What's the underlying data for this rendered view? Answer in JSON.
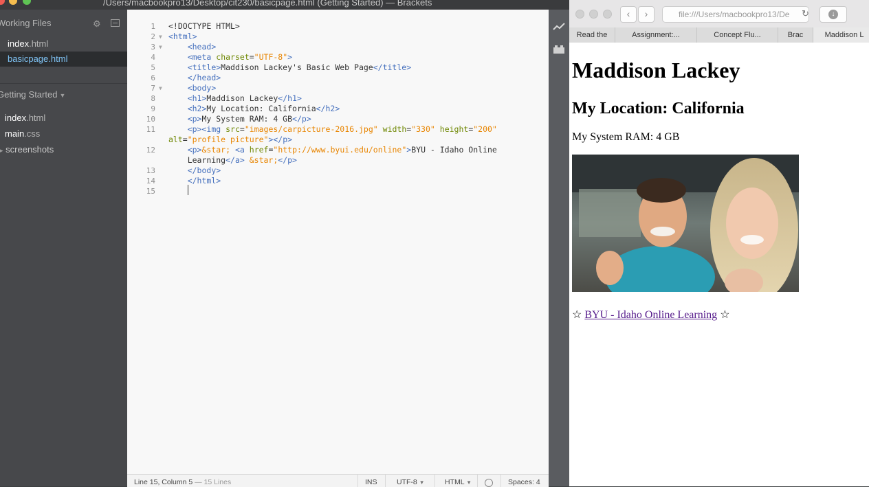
{
  "window": {
    "title": "/Users/macbookpro13/Desktop/cit230/basicpage.html (Getting Started) — Brackets"
  },
  "sidebar": {
    "working_files_title": "Working Files",
    "working_files": [
      {
        "name": "index",
        "ext": ".html",
        "selected": false
      },
      {
        "name": "basicpage",
        "ext": ".html",
        "selected": true
      }
    ],
    "project_title": "Getting Started",
    "project_items": [
      {
        "name": "index",
        "ext": ".html"
      },
      {
        "name": "main",
        "ext": ".css"
      },
      {
        "name": "screenshots",
        "ext": ""
      }
    ]
  },
  "editor": {
    "lines": [
      {
        "num": "1",
        "fold": "",
        "html": "&lt;!DOCTYPE HTML&gt;"
      },
      {
        "num": "2",
        "fold": "▼",
        "html": "<span class='tag'>&lt;html&gt;</span>"
      },
      {
        "num": "3",
        "fold": "▼",
        "html": "    <span class='tag'>&lt;head&gt;</span>"
      },
      {
        "num": "4",
        "fold": "",
        "html": "    <span class='tag'>&lt;meta</span> <span class='attr'>charset</span>=<span class='str'>\"UTF-8\"</span><span class='tag'>&gt;</span>"
      },
      {
        "num": "5",
        "fold": "",
        "html": "    <span class='tag'>&lt;title&gt;</span>Maddison Lackey's Basic Web Page<span class='tag'>&lt;/title&gt;</span>"
      },
      {
        "num": "6",
        "fold": "",
        "html": "    <span class='tag'>&lt;/head&gt;</span>"
      },
      {
        "num": "7",
        "fold": "▼",
        "html": "    <span class='tag'>&lt;body&gt;</span>"
      },
      {
        "num": "8",
        "fold": "",
        "html": "    <span class='tag'>&lt;h1&gt;</span>Maddison Lackey<span class='tag'>&lt;/h1&gt;</span>"
      },
      {
        "num": "9",
        "fold": "",
        "html": "    <span class='tag'>&lt;h2&gt;</span>My Location: California<span class='tag'>&lt;/h2&gt;</span>"
      },
      {
        "num": "10",
        "fold": "",
        "html": "    <span class='tag'>&lt;p&gt;</span>My System RAM: 4 GB<span class='tag'>&lt;/p&gt;</span>"
      },
      {
        "num": "11",
        "fold": "",
        "html": "    <span class='tag'>&lt;p&gt;&lt;img</span> <span class='attr'>src</span>=<span class='str'>\"images/carpicture-2016.jpg\"</span> <span class='attr'>width</span>=<span class='str'>\"330\"</span> <span class='attr'>height</span>=<span class='str'>\"200\"</span>"
      },
      {
        "num": "",
        "fold": "",
        "html": "<span class='attr'>alt</span>=<span class='str'>\"profile picture\"</span><span class='tag'>&gt;&lt;/p&gt;</span>"
      },
      {
        "num": "12",
        "fold": "",
        "html": "    <span class='tag'>&lt;p&gt;</span><span class='ent'>&amp;star;</span> <span class='tag'>&lt;a</span> <span class='attr'>href</span>=<span class='str'>\"http://www.byui.edu/online\"</span><span class='tag'>&gt;</span>BYU - Idaho Online"
      },
      {
        "num": "",
        "fold": "",
        "html": "    Learning<span class='tag'>&lt;/a&gt;</span> <span class='ent'>&amp;star;</span><span class='tag'>&lt;/p&gt;</span>"
      },
      {
        "num": "13",
        "fold": "",
        "html": "    <span class='tag'>&lt;/body&gt;</span>"
      },
      {
        "num": "14",
        "fold": "",
        "html": "    <span class='tag'>&lt;/html&gt;</span>"
      },
      {
        "num": "15",
        "fold": "",
        "html": ""
      }
    ]
  },
  "status": {
    "position": "Line 15, Column 5",
    "line_count": "— 15 Lines",
    "mode_ins": "INS",
    "encoding": "UTF-8",
    "language": "HTML",
    "spaces_label": "Spaces:",
    "spaces_value": "4"
  },
  "safari": {
    "url": "file:///Users/macbookpro13/De",
    "tabs": [
      "Read the",
      "Assignment:...",
      "Concept Flu...",
      "Brac",
      "Maddison L"
    ]
  },
  "preview": {
    "h1": "Maddison Lackey",
    "h2": "My Location: California",
    "ram": "My System RAM: 4 GB",
    "star": "☆",
    "link_text": "BYU - Idaho Online Learning"
  }
}
